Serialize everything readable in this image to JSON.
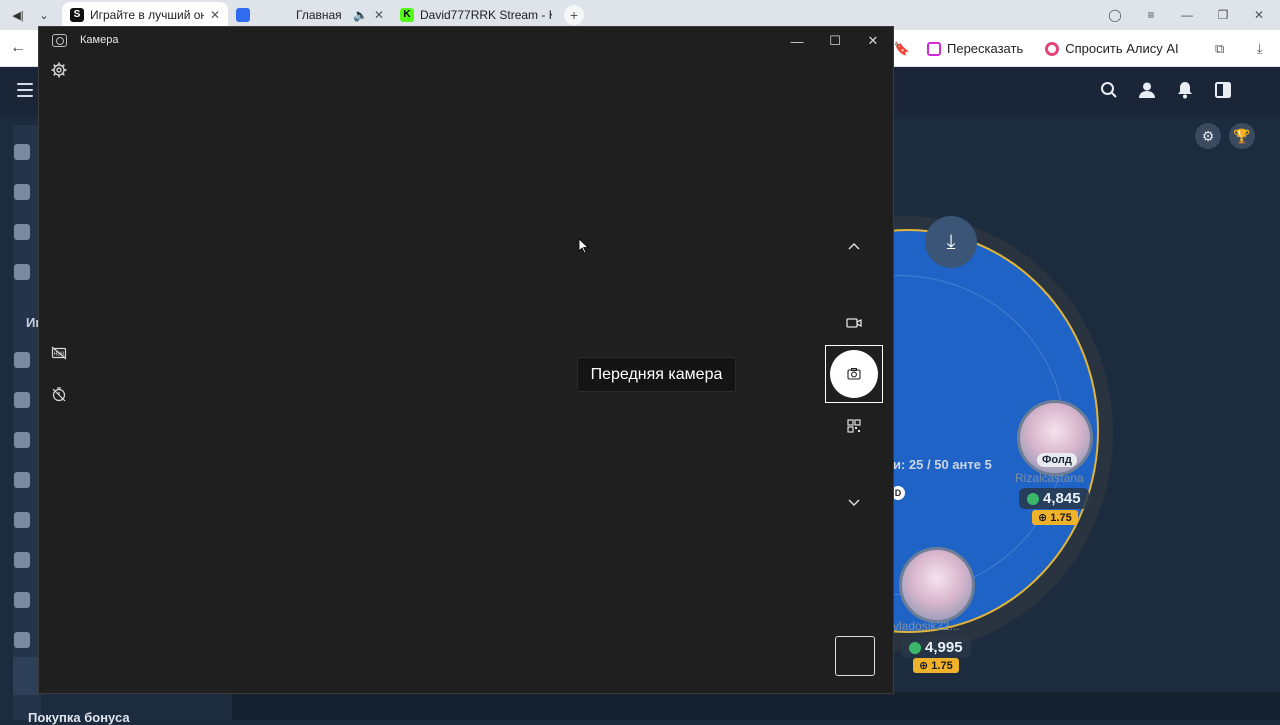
{
  "browser": {
    "tabs": [
      {
        "label": "Играйте в лучший онл",
        "favicon": "S",
        "active": true
      },
      {
        "label": "Главная",
        "favicon": "",
        "active": false
      },
      {
        "label": "David777RRK Stream - Kic",
        "favicon": "K",
        "active": false
      }
    ],
    "actions": {
      "retell_label": "Пересказать",
      "alice_label": "Спросить Алису AI"
    }
  },
  "site": {
    "sidebar_partial_label": "Иг",
    "bonus_label": "Покупка бонуса",
    "table": {
      "players": [
        {
          "name": "Rizalcastana",
          "status": "Фолд",
          "stack": "4,845",
          "bet": "1.75"
        },
        {
          "name": "vladosik22...",
          "stack": "4,995",
          "bet": "1.75"
        }
      ],
      "blinds_text": "и: 25 / 50 анте 5"
    }
  },
  "camera": {
    "title": "Камера",
    "tooltip": "Передняя камера",
    "icons": [
      "settings-icon",
      "hdr-off-icon",
      "timer-off-icon",
      "chevron-up-icon",
      "video-mode-icon",
      "photo-mode-icon",
      "qr-scan-icon",
      "chevron-down-icon"
    ]
  }
}
